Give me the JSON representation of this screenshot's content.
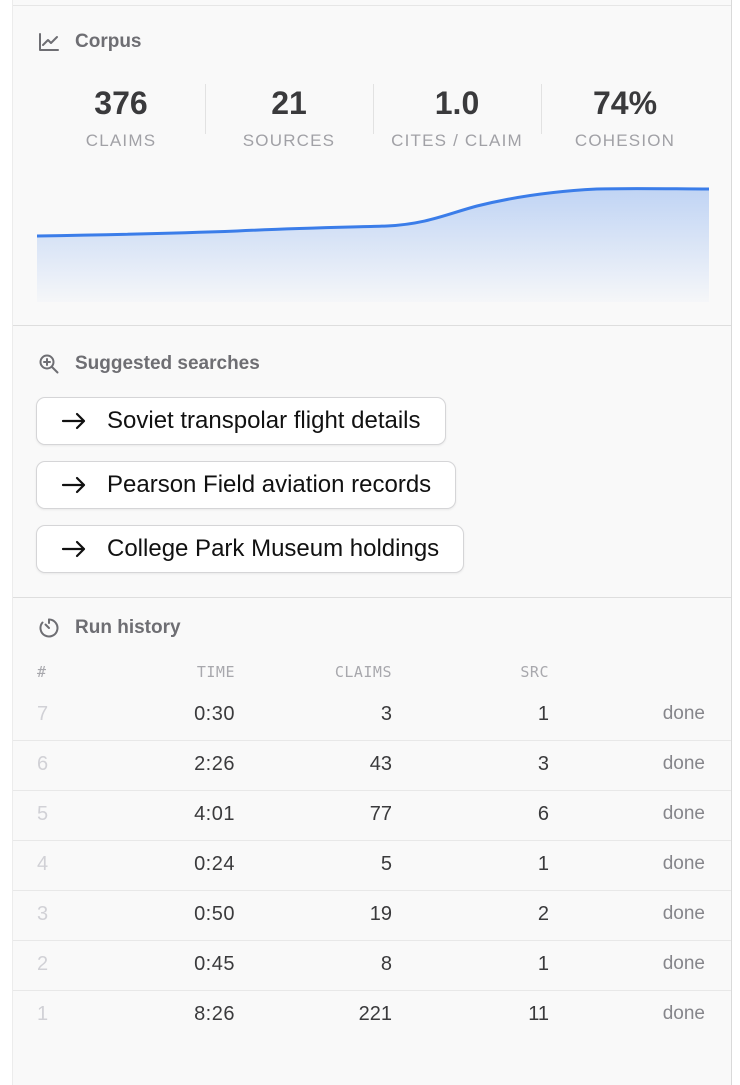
{
  "corpus": {
    "title": "Corpus",
    "stats": [
      {
        "value": "376",
        "label": "CLAIMS"
      },
      {
        "value": "21",
        "label": "SOURCES"
      },
      {
        "value": "1.0",
        "label": "CITES / CLAIM"
      },
      {
        "value": "74%",
        "label": "COHESION"
      }
    ],
    "accent_color": "#3b7de9"
  },
  "suggested": {
    "title": "Suggested searches",
    "items": [
      {
        "label": "Soviet transpolar flight details"
      },
      {
        "label": "Pearson Field aviation records"
      },
      {
        "label": "College Park Museum holdings"
      }
    ]
  },
  "history": {
    "title": "Run history",
    "columns": {
      "num": "#",
      "time": "TIME",
      "claims": "CLAIMS",
      "src": "SRC"
    },
    "rows": [
      {
        "num": "7",
        "time": "0:30",
        "claims": "3",
        "src": "1",
        "status": "done"
      },
      {
        "num": "6",
        "time": "2:26",
        "claims": "43",
        "src": "3",
        "status": "done"
      },
      {
        "num": "5",
        "time": "4:01",
        "claims": "77",
        "src": "6",
        "status": "done"
      },
      {
        "num": "4",
        "time": "0:24",
        "claims": "5",
        "src": "1",
        "status": "done"
      },
      {
        "num": "3",
        "time": "0:50",
        "claims": "19",
        "src": "2",
        "status": "done"
      },
      {
        "num": "2",
        "time": "0:45",
        "claims": "8",
        "src": "1",
        "status": "done"
      },
      {
        "num": "1",
        "time": "8:26",
        "claims": "221",
        "src": "11",
        "status": "done"
      }
    ]
  }
}
